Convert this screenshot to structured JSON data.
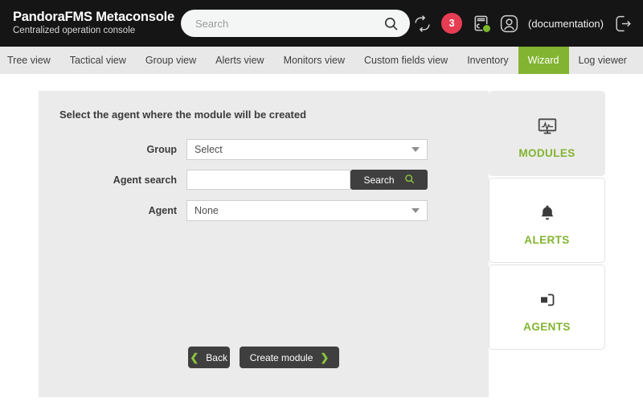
{
  "header": {
    "brand_title": "PandoraFMS Metaconsole",
    "brand_subtitle": "Centralized operation console",
    "search_placeholder": "Search",
    "search_value": "",
    "search_icon": "magnifier-icon",
    "refresh_icon": "refresh-icon",
    "notification_count": "3",
    "disk_icon": "save-disk-icon",
    "disk_status_color": "#7ab82b",
    "user_icon": "user-avatar-icon",
    "documentation_label": "(documentation)",
    "logout_icon": "logout-icon",
    "background_color": "#151515"
  },
  "nav": {
    "active_color": "#82b431",
    "items": [
      {
        "label": "Tree view",
        "active": false
      },
      {
        "label": "Tactical view",
        "active": false
      },
      {
        "label": "Group view",
        "active": false
      },
      {
        "label": "Alerts view",
        "active": false
      },
      {
        "label": "Monitors view",
        "active": false
      },
      {
        "label": "Custom fields view",
        "active": false
      },
      {
        "label": "Inventory",
        "active": false
      },
      {
        "label": "Wizard",
        "active": true
      },
      {
        "label": "Log viewer",
        "active": false
      }
    ]
  },
  "form": {
    "title": "Select the agent where the module will be created",
    "group_label": "Group",
    "group_value": "Select",
    "agent_search_label": "Agent search",
    "agent_search_value": "",
    "search_button_label": "Search",
    "search_button_icon": "magnifier-icon",
    "agent_label": "Agent",
    "agent_value": "None",
    "back_button_label": "Back",
    "back_button_icon": "chevron-left-icon",
    "create_button_label": "Create module",
    "create_button_icon": "chevron-right-icon",
    "panel_color": "#ebebeb"
  },
  "sidebar": {
    "cards": [
      {
        "label": "MODULES",
        "icon": "monitor-pulse-icon",
        "active": true
      },
      {
        "label": "ALERTS",
        "icon": "bell-icon",
        "active": false
      },
      {
        "label": "AGENTS",
        "icon": "agent-login-icon",
        "active": false
      }
    ],
    "label_color": "#82b431"
  }
}
